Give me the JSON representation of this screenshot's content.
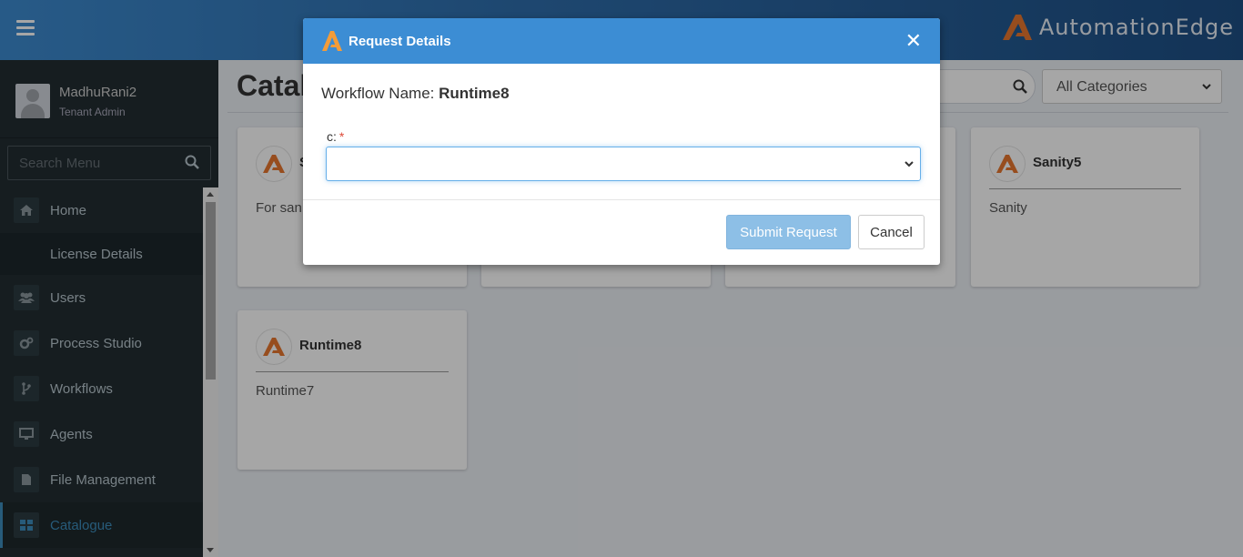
{
  "header": {
    "brand_text": "AutomationEdge",
    "brand_color": "#e8772e"
  },
  "sidebar": {
    "user": {
      "name": "MadhuRani2",
      "role": "Tenant Admin"
    },
    "search_placeholder": "Search Menu",
    "items": [
      {
        "label": "Home",
        "icon": "home-icon"
      },
      {
        "label": "License Details",
        "icon": ""
      },
      {
        "label": "Users",
        "icon": "users-icon"
      },
      {
        "label": "Process Studio",
        "icon": "gears-icon"
      },
      {
        "label": "Workflows",
        "icon": "workflow-icon"
      },
      {
        "label": "Agents",
        "icon": "monitor-icon"
      },
      {
        "label": "File Management",
        "icon": "file-icon"
      },
      {
        "label": "Catalogue",
        "icon": "grid-icon"
      }
    ]
  },
  "main": {
    "title": "Catal",
    "category_filter": "All Categories",
    "cards": [
      {
        "name": "S",
        "description": "For san"
      },
      {
        "name": "Sanity5",
        "description": "Sanity"
      },
      {
        "name": "Runtime8",
        "description": "Runtime7"
      }
    ]
  },
  "modal": {
    "title": "Request Details",
    "close_label": "✕",
    "workflow_label": "Workflow Name:",
    "workflow_name": "Runtime8",
    "field_label": "c:",
    "required_mark": "*",
    "submit_label": "Submit Request",
    "cancel_label": "Cancel",
    "accent_color": "#3c8dd4"
  }
}
